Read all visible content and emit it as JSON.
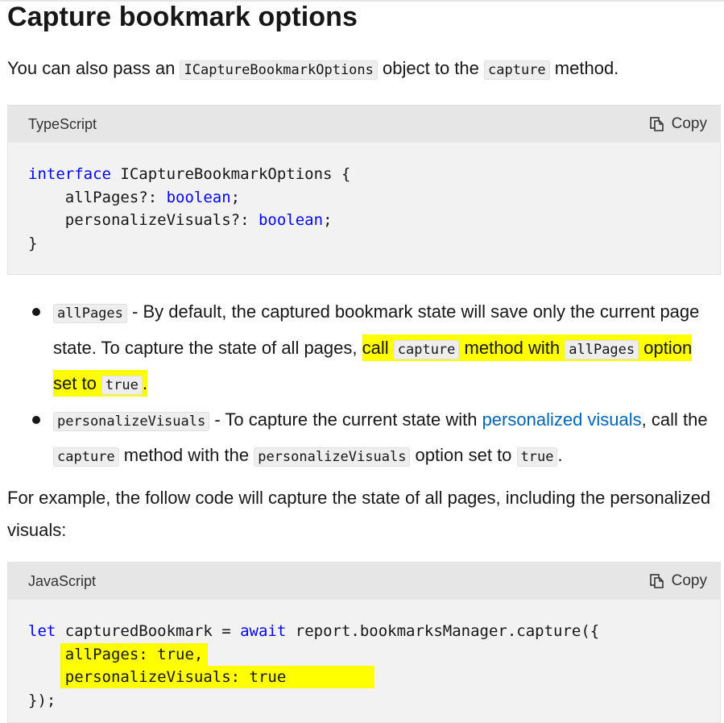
{
  "heading": "Capture bookmark options",
  "intro": {
    "before": "You can also pass an",
    "code1": "ICaptureBookmarkOptions",
    "middle": "object to the",
    "code2": "capture",
    "after": "method."
  },
  "ts_block": {
    "language": "TypeScript",
    "copy_label": "Copy",
    "lines": {
      "l1_kw": "interface",
      "l1_rest": " ICaptureBookmarkOptions {",
      "l2_pre": "    allPages?: ",
      "l2_type": "boolean",
      "l2_post": ";",
      "l3_pre": "    personalizeVisuals?: ",
      "l3_type": "boolean",
      "l3_post": ";",
      "l4": "}"
    }
  },
  "options": [
    {
      "code": "allPages",
      "text1": " - By default, the captured bookmark state will save only the current page state. To capture the state of all pages, ",
      "hl_a": "call ",
      "hl_code1": "capture",
      "hl_b": " method with ",
      "hl_code2": "allPages",
      "hl_c": " option set to ",
      "hl_code3": "true",
      "hl_d": "."
    },
    {
      "code": "personalizeVisuals",
      "text1": " - To capture the current state with ",
      "link": "personalized visuals",
      "text2": ", call the ",
      "code2": "capture",
      "text3": " method with the ",
      "code3": "personalizeVisuals",
      "text4": " option set to ",
      "code4": "true",
      "text5": "."
    }
  ],
  "example_text": "For example, the follow code will capture the state of all pages, including the personalized visuals:",
  "js_block": {
    "language": "JavaScript",
    "copy_label": "Copy",
    "lines": {
      "l1_kw1": "let",
      "l1_mid": " capturedBookmark = ",
      "l1_kw2": "await",
      "l1_rest": " report.bookmarksManager.capture({",
      "l2": "allPages: true,",
      "l3": "personalizeVisuals: true",
      "l4": "});"
    }
  },
  "colors": {
    "keyword": "#0101fd",
    "link": "#0065b3",
    "highlight": "#ffff00"
  },
  "icons": {
    "copy": "copy-icon"
  }
}
